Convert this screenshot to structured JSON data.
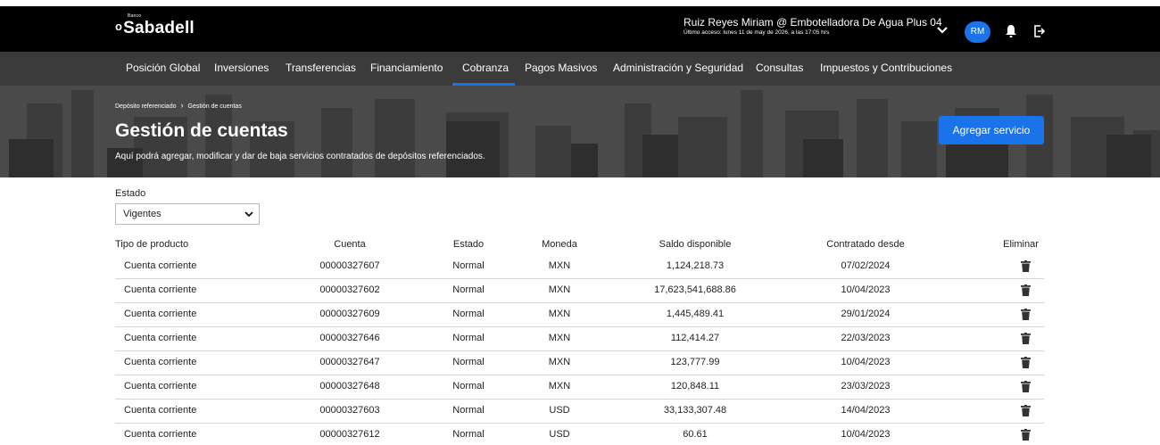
{
  "header": {
    "logo_text": "Sabadell",
    "logo_small": "Banco",
    "user_name": "Ruiz Reyes Miriam @ Embotelladora De Agua Plus 04",
    "last_access": "Último acceso: lunes 11 de may de 2026, a las 17:05 hrs",
    "avatar_initials": "RM"
  },
  "nav": {
    "items": [
      {
        "label": "Posición Global"
      },
      {
        "label": "Inversiones"
      },
      {
        "label": "Transferencias"
      },
      {
        "label": "Financiamiento"
      },
      {
        "label": "Cobranza"
      },
      {
        "label": "Pagos Masivos"
      },
      {
        "label": "Administración y Seguridad"
      },
      {
        "label": "Consultas"
      },
      {
        "label": "Impuestos y Contribuciones"
      }
    ],
    "active": "Cobranza"
  },
  "hero": {
    "breadcrumb": [
      "Depósito referenciado",
      "Gestión de cuentas"
    ],
    "title": "Gestión de cuentas",
    "subtitle": "Aquí podrá agregar, modificar y dar de baja servicios contratados de depósitos referenciados.",
    "add_button": "Agregar servicio"
  },
  "filter": {
    "label": "Estado",
    "selected": "Vigentes"
  },
  "table": {
    "headers": [
      "Tipo de producto",
      "Cuenta",
      "Estado",
      "Moneda",
      "Saldo disponible",
      "Contratado desde",
      "Eliminar"
    ],
    "rows": [
      {
        "tipo": "Cuenta corriente",
        "cuenta": "00000327607",
        "estado": "Normal",
        "moneda": "MXN",
        "saldo": "1,124,218.73",
        "desde": "07/02/2024"
      },
      {
        "tipo": "Cuenta corriente",
        "cuenta": "00000327602",
        "estado": "Normal",
        "moneda": "MXN",
        "saldo": "17,623,541,688.86",
        "desde": "10/04/2023"
      },
      {
        "tipo": "Cuenta corriente",
        "cuenta": "00000327609",
        "estado": "Normal",
        "moneda": "MXN",
        "saldo": "1,445,489.41",
        "desde": "29/01/2024"
      },
      {
        "tipo": "Cuenta corriente",
        "cuenta": "00000327646",
        "estado": "Normal",
        "moneda": "MXN",
        "saldo": "112,414.27",
        "desde": "22/03/2023"
      },
      {
        "tipo": "Cuenta corriente",
        "cuenta": "00000327647",
        "estado": "Normal",
        "moneda": "MXN",
        "saldo": "123,777.99",
        "desde": "10/04/2023"
      },
      {
        "tipo": "Cuenta corriente",
        "cuenta": "00000327648",
        "estado": "Normal",
        "moneda": "MXN",
        "saldo": "120,848.11",
        "desde": "23/03/2023"
      },
      {
        "tipo": "Cuenta corriente",
        "cuenta": "00000327603",
        "estado": "Normal",
        "moneda": "USD",
        "saldo": "33,133,307.48",
        "desde": "14/04/2023"
      },
      {
        "tipo": "Cuenta corriente",
        "cuenta": "00000327612",
        "estado": "Normal",
        "moneda": "USD",
        "saldo": "60.61",
        "desde": "10/04/2023"
      }
    ]
  },
  "colors": {
    "accent": "#1a73e8",
    "topbar": "#000000",
    "nav": "#3b3b3b"
  }
}
